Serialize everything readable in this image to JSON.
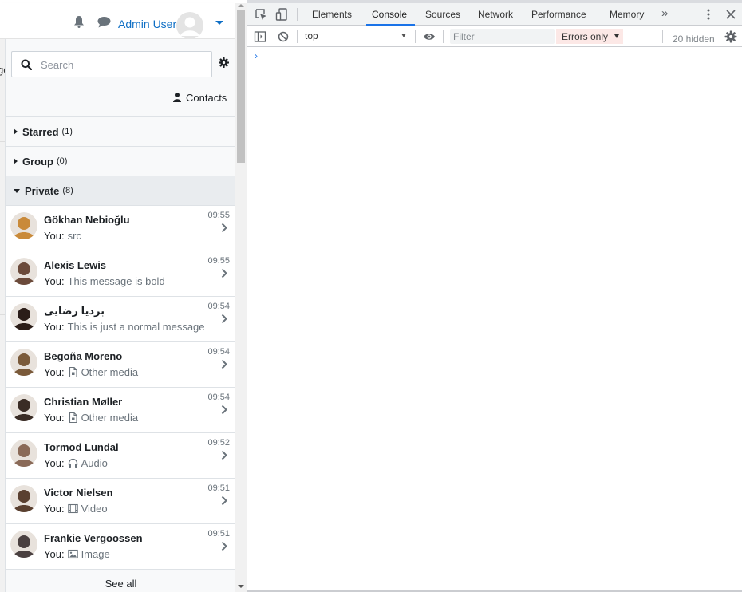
{
  "header": {
    "user_name": "Admin User",
    "icons": [
      "bell-icon",
      "chat-icon",
      "avatar",
      "caret-down-icon"
    ]
  },
  "drawer": {
    "search_placeholder": "Search",
    "contacts_label": "Contacts",
    "sections": [
      {
        "name": "Starred",
        "count": "(1)",
        "expanded": false
      },
      {
        "name": "Group",
        "count": "(0)",
        "expanded": false
      },
      {
        "name": "Private",
        "count": "(8)",
        "expanded": true
      }
    ],
    "conversations": [
      {
        "name": "Gökhan Nebioğlu",
        "you": "You:",
        "preview": "src",
        "preview_icon": "",
        "time": "09:55",
        "avatar_color": "#c98a3a"
      },
      {
        "name": "Alexis Lewis",
        "you": "You:",
        "preview": "This message is bold",
        "preview_icon": "",
        "time": "09:55",
        "avatar_color": "#6b4a3a"
      },
      {
        "name": "بردیا رضایی",
        "you": "You:",
        "preview": "This is just a normal message",
        "preview_icon": "",
        "time": "09:54",
        "avatar_color": "#2b1d18"
      },
      {
        "name": "Begoña Moreno",
        "you": "You:",
        "preview": "Other media",
        "preview_icon": "file-icon",
        "time": "09:54",
        "avatar_color": "#7a5a3a"
      },
      {
        "name": "Christian Møller",
        "you": "You:",
        "preview": "Other media",
        "preview_icon": "file-icon",
        "time": "09:54",
        "avatar_color": "#3a2c25"
      },
      {
        "name": "Tormod Lundal",
        "you": "You:",
        "preview": "Audio",
        "preview_icon": "headphones-icon",
        "time": "09:52",
        "avatar_color": "#8a6a58"
      },
      {
        "name": "Victor Nielsen",
        "you": "You:",
        "preview": "Video",
        "preview_icon": "film-icon",
        "time": "09:51",
        "avatar_color": "#5a4030"
      },
      {
        "name": "Frankie Vergoossen",
        "you": "You:",
        "preview": "Image",
        "preview_icon": "image-icon",
        "time": "09:51",
        "avatar_color": "#4a4040"
      }
    ],
    "see_all": "See all",
    "page_fragment": "ge"
  },
  "devtools": {
    "tabs": [
      "Elements",
      "Console",
      "Sources",
      "Network",
      "Performance",
      "Memory"
    ],
    "active_tab": "Console",
    "more_tabs": "»",
    "context": "top",
    "filter_placeholder": "Filter",
    "levels": "Errors only",
    "hidden_count": "20 hidden",
    "prompt": "›"
  }
}
